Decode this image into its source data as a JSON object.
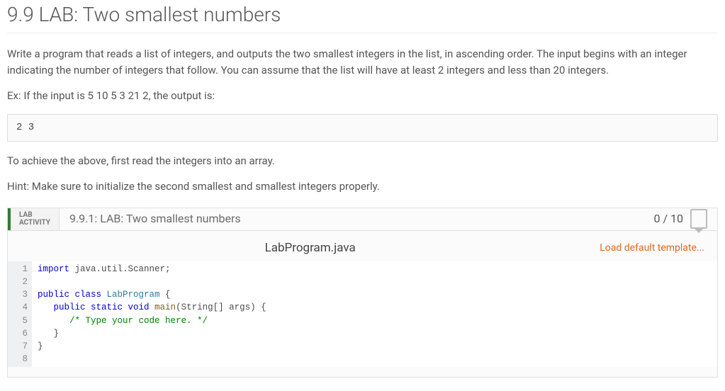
{
  "title": "9.9 LAB: Two smallest numbers",
  "prose": {
    "p1": "Write a program that reads a list of integers, and outputs the two smallest integers in the list, in ascending order. The input begins with an integer indicating the number of integers that follow. You can assume that the list will have at least 2 integers and less than 20 integers.",
    "p2": "Ex: If the input is 5 10 5 3 21 2, the output is:",
    "p3": "To achieve the above, first read the integers into an array.",
    "p4": "Hint: Make sure to initialize the second smallest and smallest integers properly."
  },
  "example_output": "2 3",
  "activity": {
    "badge_line1": "LAB",
    "badge_line2": "ACTIVITY",
    "title": "9.9.1: LAB: Two smallest numbers",
    "score": "0 / 10"
  },
  "code": {
    "filename": "LabProgram.java",
    "load_template_label": "Load default template...",
    "lines": [
      [
        {
          "t": "import ",
          "c": "kw"
        },
        {
          "t": "java.util.Scanner;",
          "c": ""
        }
      ],
      [
        {
          "t": "",
          "c": ""
        }
      ],
      [
        {
          "t": "public class ",
          "c": "kw"
        },
        {
          "t": "LabProgram",
          "c": "cls"
        },
        {
          "t": " {",
          "c": ""
        }
      ],
      [
        {
          "t": "   ",
          "c": ""
        },
        {
          "t": "public static void ",
          "c": "kw"
        },
        {
          "t": "main",
          "c": "fn"
        },
        {
          "t": "(String[] args) {",
          "c": ""
        }
      ],
      [
        {
          "t": "      ",
          "c": ""
        },
        {
          "t": "/* Type your code here. */",
          "c": "cmt"
        }
      ],
      [
        {
          "t": "   }",
          "c": ""
        }
      ],
      [
        {
          "t": "}",
          "c": ""
        }
      ],
      [
        {
          "t": "",
          "c": ""
        }
      ]
    ]
  }
}
